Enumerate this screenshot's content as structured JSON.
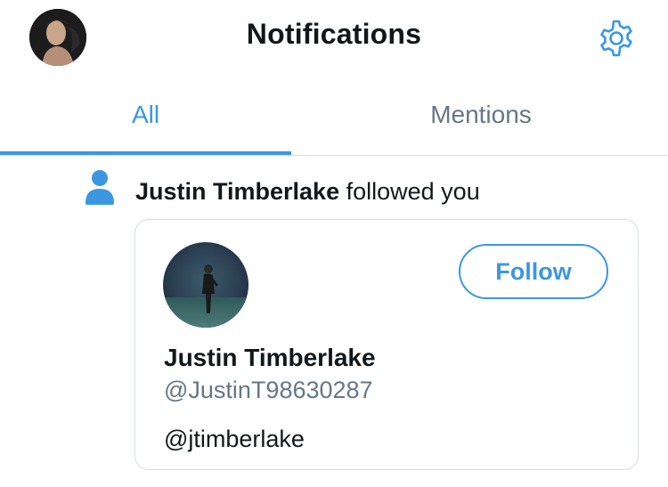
{
  "header": {
    "title": "Notifications",
    "avatar_icon": "user-avatar",
    "settings_icon": "gear-icon"
  },
  "tabs": [
    {
      "label": "All",
      "active": true
    },
    {
      "label": "Mentions",
      "active": false
    }
  ],
  "notification": {
    "icon": "person-icon",
    "actor": "Justin Timberlake",
    "action": "followed you"
  },
  "card": {
    "name": "Justin Timberlake",
    "handle": "@JustinT98630287",
    "bio": "@jtimberlake",
    "follow_label": "Follow"
  },
  "colors": {
    "accent": "#3c97e0",
    "muted": "#657786",
    "text": "#14171a",
    "border": "#d8dde2"
  }
}
